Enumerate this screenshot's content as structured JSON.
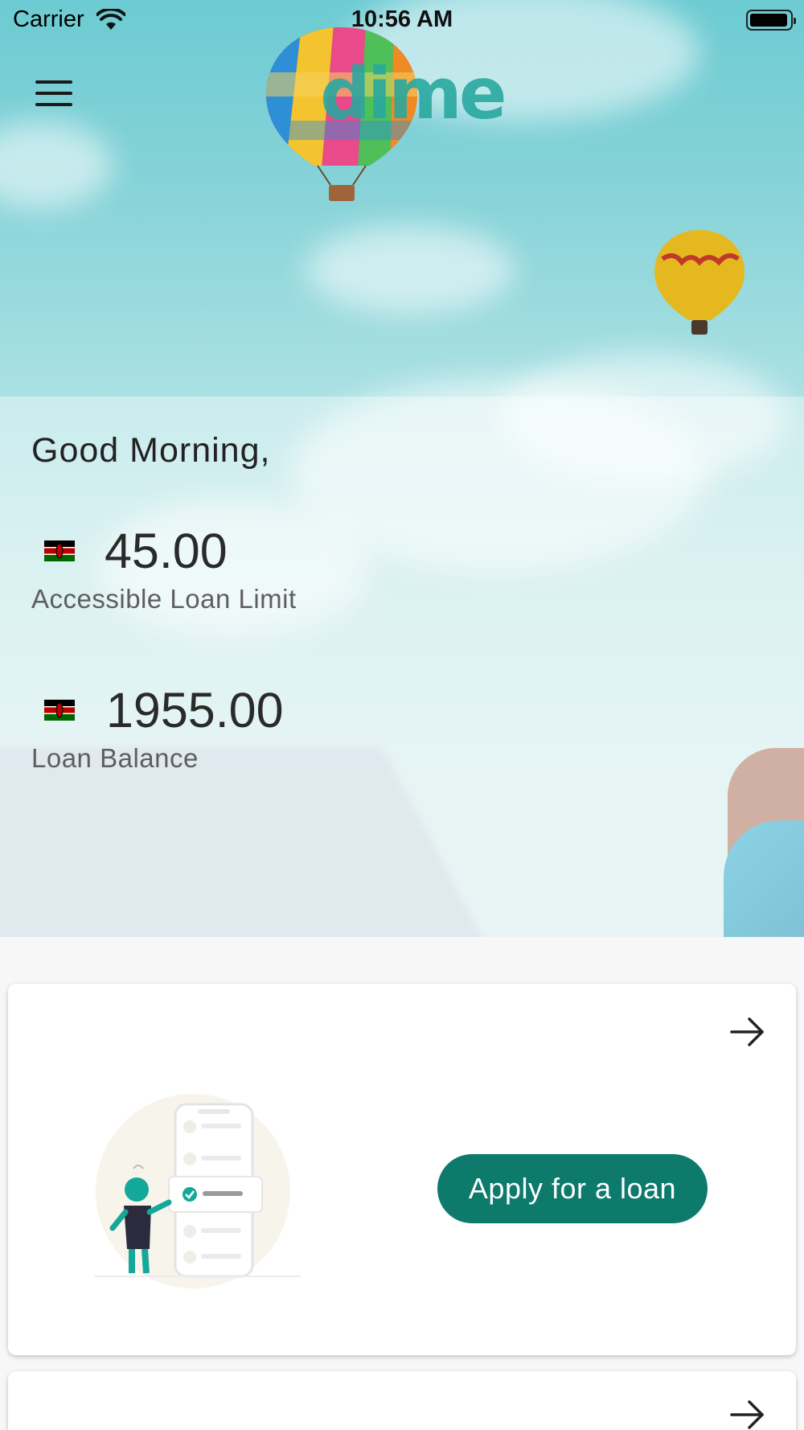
{
  "status_bar": {
    "carrier": "Carrier",
    "time": "10:56 AM"
  },
  "header": {
    "menu_icon": "hamburger-menu-icon",
    "logo_text": "dime"
  },
  "dashboard": {
    "greeting": "Good Morning,",
    "balances": [
      {
        "flag_icon": "kenya-flag-icon",
        "amount": "45.00",
        "label": "Accessible Loan Limit"
      },
      {
        "flag_icon": "kenya-flag-icon",
        "amount": "1955.00",
        "label": "Loan Balance"
      }
    ]
  },
  "cards": [
    {
      "action_label": "Apply for a loan",
      "arrow_icon": "arrow-right-icon",
      "illustration": "loan-application-illustration"
    },
    {
      "arrow_icon": "arrow-right-icon"
    }
  ],
  "colors": {
    "primary": "#0d7a6c",
    "logo": "#29a89f",
    "sky": "#6ccbd2"
  }
}
